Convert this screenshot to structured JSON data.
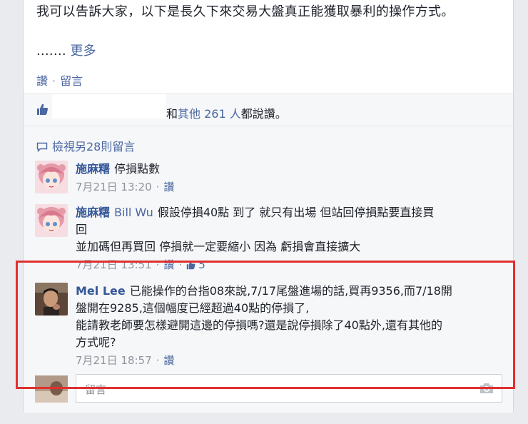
{
  "post": {
    "text": "我可以告訴大家，以下是長久下來交易大盤真正能獲取暴利的操作方式。",
    "ellipsis": ".……",
    "more_link": "更多",
    "like_label": "讚",
    "comment_label": "留言"
  },
  "likes": {
    "and_text": "和",
    "others_link": "其他 261 人",
    "suffix": "都說讚。"
  },
  "view_more": "檢視另28則留言",
  "comments": [
    {
      "name": "施麻糬",
      "text": "停損點數",
      "time": "7月21日 13:20",
      "like_label": "讚"
    },
    {
      "name": "施麻糬",
      "mention": "Bill Wu",
      "text_lines": [
        "假設停損40點 到了 就只有出場 但站回停損點要直接買",
        "回",
        "並加碼但再買回 停損就一定要縮小 因為 虧損會直接擴大"
      ],
      "time": "7月21日 13:51",
      "like_label": "讚",
      "likes": "5"
    },
    {
      "name": "Mel Lee",
      "text_lines": [
        "已能操作的台指08來說,7/17尾盤進場的話,買再9356,而7/18開",
        "盤開在9285,這個幅度已經超過40點的停損了,",
        "能請教老師要怎樣避開這邊的停損嗎?還是說停損除了40點外,還有其他的",
        "方式呢?"
      ],
      "time": "7月21日 18:57",
      "like_label": "讚"
    }
  ],
  "reply": {
    "placeholder": "留言"
  },
  "colors": {
    "link": "#4b67a1",
    "name": "#365899",
    "highlight": "#e03030"
  }
}
